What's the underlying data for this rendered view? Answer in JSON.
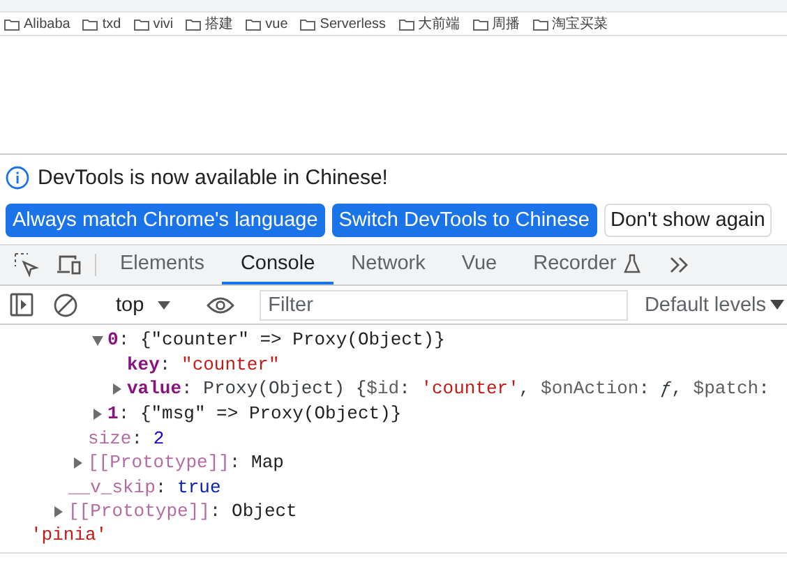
{
  "browser": {
    "bookmarks": [
      "Alibaba",
      "txd",
      "vivi",
      "搭建",
      "vue",
      "Serverless",
      "大前端",
      "周播",
      "淘宝买菜"
    ]
  },
  "infobar": {
    "message": "DevTools is now available in Chinese!",
    "buttons": [
      {
        "label": "Always match Chrome's language",
        "primary": true
      },
      {
        "label": "Switch DevTools to Chinese",
        "primary": true
      },
      {
        "label": "Don't show again",
        "primary": false
      }
    ]
  },
  "tabs": [
    {
      "label": "Elements",
      "selected": false,
      "kind": "plain"
    },
    {
      "label": "Console",
      "selected": true,
      "kind": "plain"
    },
    {
      "label": "Network",
      "selected": false,
      "kind": "plain"
    },
    {
      "label": "Vue",
      "selected": false,
      "kind": "plain"
    },
    {
      "label": "Recorder",
      "selected": false,
      "kind": "experimental"
    }
  ],
  "console_toolbar": {
    "context": "top",
    "filter": {
      "placeholder": "Filter"
    },
    "levels": "Default levels"
  },
  "console": {
    "rows": [
      {
        "kind": "group",
        "children": [
          {
            "kind": "group",
            "children": [
              {
                "kind": "group",
                "children": [
                  {
                    "kind": "property",
                    "name": "0",
                    "sep": ":",
                    "dimmed": false,
                    "expanded": true,
                    "value": [
                      {
                        "text": "{\"counter\" => Proxy(Object)}",
                        "kind": "plain"
                      }
                    ],
                    "children": [
                      {
                        "kind": "property",
                        "name": "key",
                        "sep": ":",
                        "dimmed": false,
                        "value": [
                          {
                            "text": "\"counter\"",
                            "kind": "string"
                          }
                        ]
                      },
                      {
                        "kind": "property",
                        "name": "value",
                        "sep": ":",
                        "dimmed": false,
                        "expanded": false,
                        "value": [
                          {
                            "text": "Proxy(Object) {",
                            "kind": "object"
                          },
                          {
                            "text": "$id",
                            "kind": "key"
                          },
                          {
                            "text": ": ",
                            "kind": "object"
                          },
                          {
                            "text": "'counter'",
                            "kind": "string"
                          },
                          {
                            "text": ", ",
                            "kind": "object"
                          },
                          {
                            "text": "$onAction",
                            "kind": "key"
                          },
                          {
                            "text": ": ",
                            "kind": "object"
                          },
                          {
                            "text": "ƒ",
                            "kind": "function"
                          },
                          {
                            "text": ", ",
                            "kind": "object"
                          },
                          {
                            "text": "$patch",
                            "kind": "key"
                          },
                          {
                            "text": ":",
                            "kind": "object"
                          }
                        ]
                      }
                    ]
                  },
                  {
                    "kind": "property",
                    "name": "1",
                    "sep": ":",
                    "dimmed": false,
                    "expanded": false,
                    "value": [
                      {
                        "text": "{\"msg\" => Proxy(Object)}",
                        "kind": "plain"
                      }
                    ]
                  }
                ]
              },
              {
                "kind": "property",
                "name": "size",
                "sep": ":",
                "dimmed": true,
                "value": [
                  {
                    "text": "2",
                    "kind": "number"
                  }
                ]
              },
              {
                "kind": "property",
                "name": "[[Prototype]]",
                "sep": ":",
                "dimmed": true,
                "expanded": false,
                "value": [
                  {
                    "text": "Map",
                    "kind": "plain"
                  }
                ]
              }
            ]
          },
          {
            "kind": "property",
            "name": "__v_skip",
            "sep": ":",
            "dimmed": true,
            "value": [
              {
                "text": "true",
                "kind": "boolean"
              }
            ]
          },
          {
            "kind": "property",
            "name": "[[Prototype]]",
            "sep": ":",
            "dimmed": true,
            "expanded": false,
            "value": [
              {
                "text": "Object",
                "kind": "plain"
              }
            ]
          }
        ]
      },
      {
        "kind": "string",
        "text": "'pinia'"
      }
    ]
  }
}
